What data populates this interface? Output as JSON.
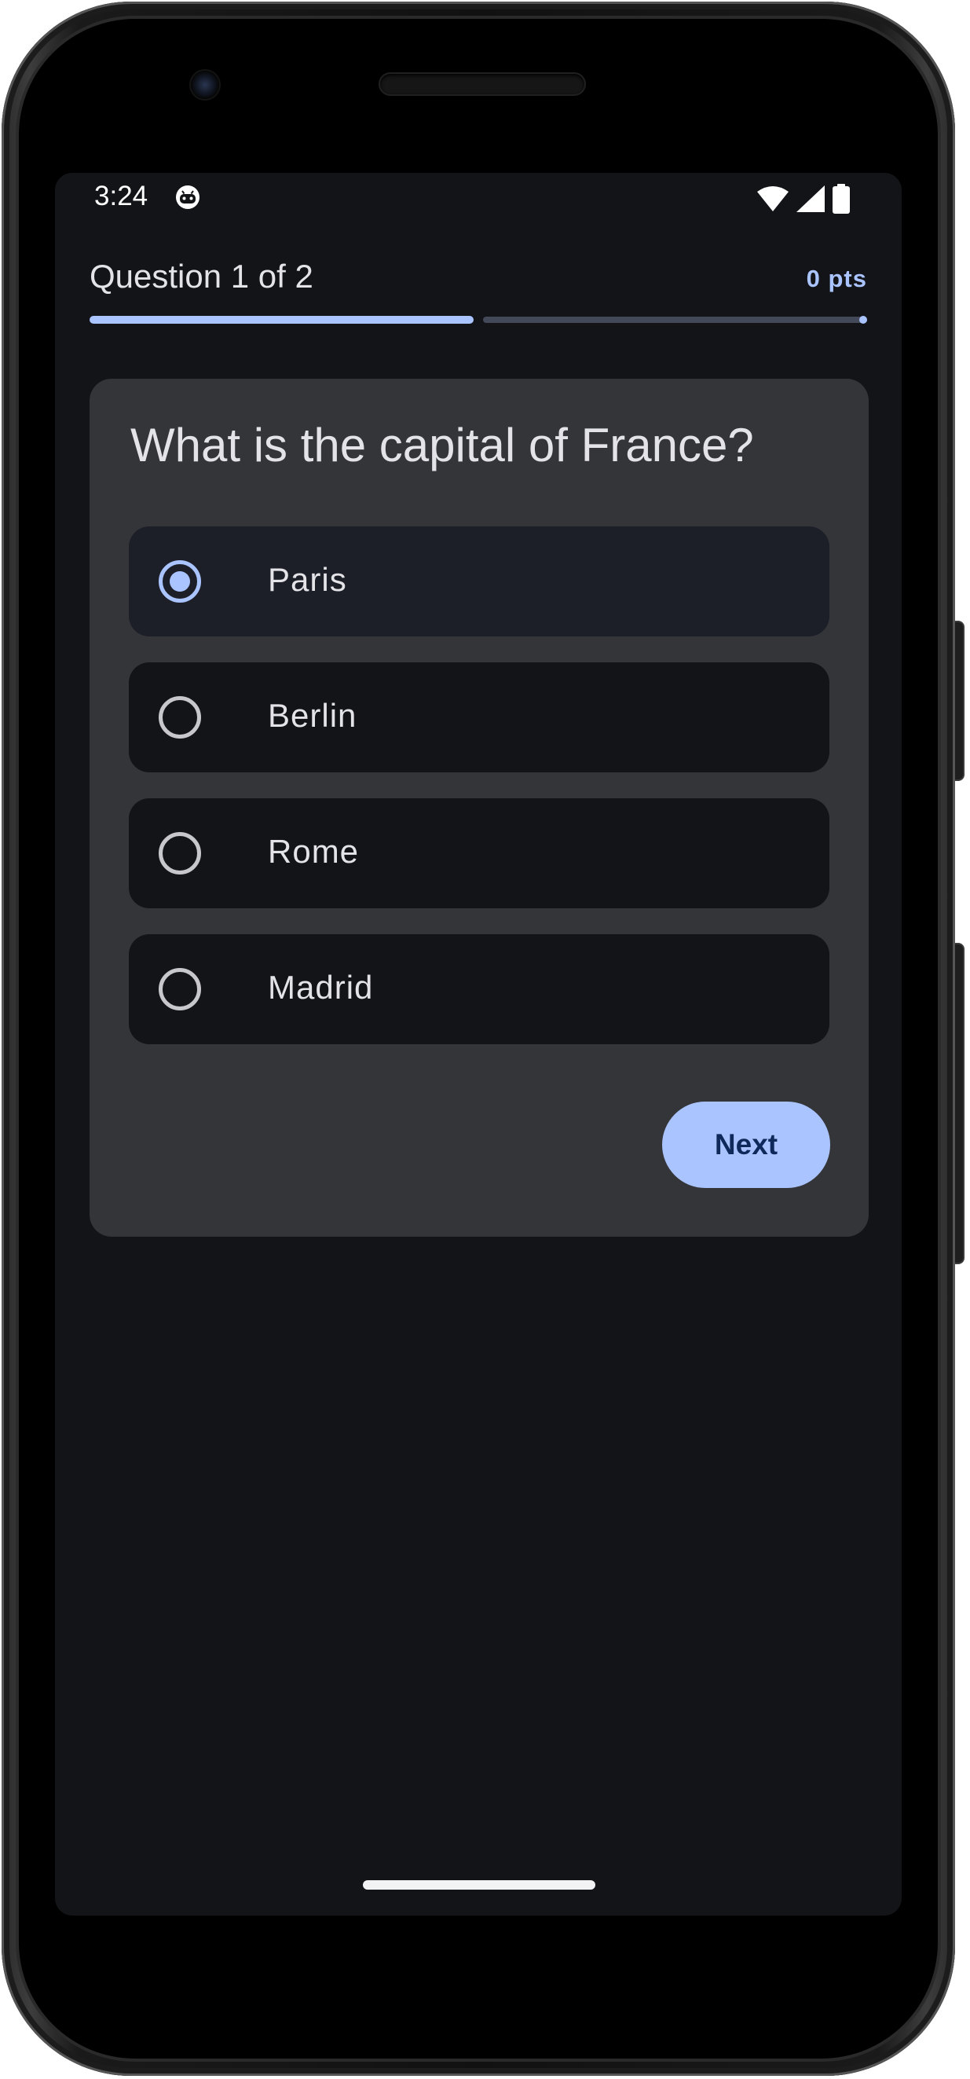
{
  "status_bar": {
    "time": "3:24",
    "app_icon": "android-robot-icon",
    "icons": [
      "wifi-icon",
      "cellular-signal-icon",
      "battery-icon"
    ]
  },
  "quiz": {
    "question_counter": "Question 1 of 2",
    "points": "0 pts",
    "progress_fraction": 0.5,
    "question": "What is the capital of France?",
    "options": [
      {
        "label": "Paris",
        "selected": true
      },
      {
        "label": "Berlin",
        "selected": false
      },
      {
        "label": "Rome",
        "selected": false
      },
      {
        "label": "Madrid",
        "selected": false
      }
    ],
    "next_label": "Next"
  },
  "colors": {
    "accent": "#aac4ff",
    "background": "#131418",
    "card": "#343539",
    "on_accent": "#0f2a5a"
  }
}
